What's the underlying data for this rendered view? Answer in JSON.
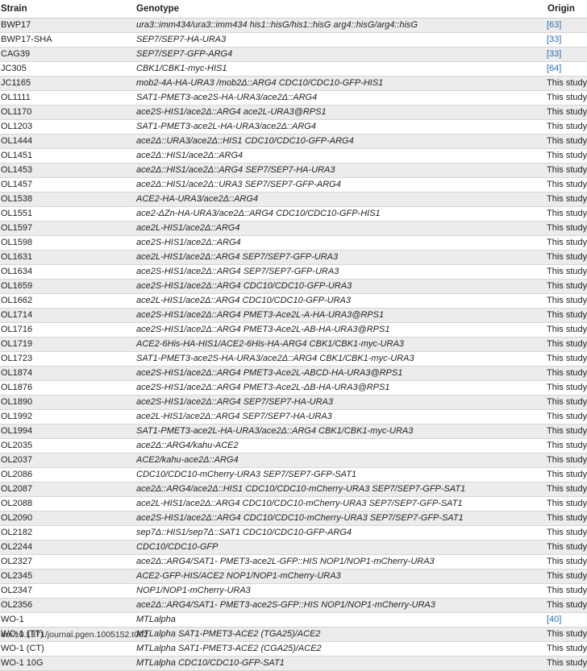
{
  "table": {
    "headers": [
      "Strain",
      "Genotype",
      "Origin"
    ],
    "rows": [
      {
        "strain": "BWP17",
        "genotype": "ura3::imm434/ura3::imm434 his1::hisG/his1::hisG arg4::hisG/arg4::hisG",
        "origin": "[63]",
        "origin_is_ref": true
      },
      {
        "strain": "BWP17-SHA",
        "genotype": "SEP7/SEP7-HA-URA3",
        "origin": "[33]",
        "origin_is_ref": true
      },
      {
        "strain": "CAG39",
        "genotype": "SEP7/SEP7-GFP-ARG4",
        "origin": "[33]",
        "origin_is_ref": true
      },
      {
        "strain": "JC305",
        "genotype": "CBK1/CBK1-myc-HIS1",
        "origin": "[64]",
        "origin_is_ref": true
      },
      {
        "strain": "JC1165",
        "genotype": "mob2-4A-HA-URA3 /mob2Δ::ARG4 CDC10/CDC10-GFP-HIS1",
        "origin": "This study",
        "origin_is_ref": false
      },
      {
        "strain": "OL1111",
        "genotype": "SAT1-PMET3-ace2S-HA-URA3/ace2Δ::ARG4",
        "origin": "This study",
        "origin_is_ref": false
      },
      {
        "strain": "OL1170",
        "genotype": "ace2S-HIS1/ace2Δ::ARG4 ace2L-URA3@RPS1",
        "origin": "This study",
        "origin_is_ref": false
      },
      {
        "strain": "OL1203",
        "genotype": "SAT1-PMET3-ace2L-HA-URA3/ace2Δ::ARG4",
        "origin": "This study",
        "origin_is_ref": false
      },
      {
        "strain": "OL1444",
        "genotype": "ace2Δ::URA3/ace2Δ::HIS1 CDC10/CDC10-GFP-ARG4",
        "origin": "This study",
        "origin_is_ref": false
      },
      {
        "strain": "OL1451",
        "genotype": "ace2Δ::HIS1/ace2Δ::ARG4",
        "origin": "This study",
        "origin_is_ref": false
      },
      {
        "strain": "OL1453",
        "genotype": "ace2Δ::HIS1/ace2Δ::ARG4 SEP7/SEP7-HA-URA3",
        "origin": "This study",
        "origin_is_ref": false
      },
      {
        "strain": "OL1457",
        "genotype": "ace2Δ::HIS1/ace2Δ::URA3 SEP7/SEP7-GFP-ARG4",
        "origin": "This study",
        "origin_is_ref": false
      },
      {
        "strain": "OL1538",
        "genotype": "ACE2-HA-URA3/ace2Δ::ARG4",
        "origin": "This study",
        "origin_is_ref": false
      },
      {
        "strain": "OL1551",
        "genotype": "ace2-ΔZn-HA-URA3/ace2Δ::ARG4 CDC10/CDC10-GFP-HIS1",
        "origin": "This study",
        "origin_is_ref": false
      },
      {
        "strain": "OL1597",
        "genotype": "ace2L-HIS1/ace2Δ::ARG4",
        "origin": "This study",
        "origin_is_ref": false
      },
      {
        "strain": "OL1598",
        "genotype": "ace2S-HIS1/ace2Δ::ARG4",
        "origin": "This study",
        "origin_is_ref": false
      },
      {
        "strain": "OL1631",
        "genotype": "ace2L-HIS1/ace2Δ::ARG4 SEP7/SEP7-GFP-URA3",
        "origin": "This study",
        "origin_is_ref": false
      },
      {
        "strain": "OL1634",
        "genotype": "ace2S-HIS1/ace2Δ::ARG4 SEP7/SEP7-GFP-URA3",
        "origin": "This study",
        "origin_is_ref": false
      },
      {
        "strain": "OL1659",
        "genotype": "ace2S-HIS1/ace2Δ::ARG4 CDC10/CDC10-GFP-URA3",
        "origin": "This study",
        "origin_is_ref": false
      },
      {
        "strain": "OL1662",
        "genotype": "ace2L-HIS1/ace2Δ::ARG4 CDC10/CDC10-GFP-URA3",
        "origin": "This study",
        "origin_is_ref": false
      },
      {
        "strain": "OL1714",
        "genotype": "ace2S-HIS1/ace2Δ::ARG4 PMET3-Ace2L-A-HA-URA3@RPS1",
        "origin": "This study",
        "origin_is_ref": false
      },
      {
        "strain": "OL1716",
        "genotype": "ace2S-HIS1/ace2Δ::ARG4 PMET3-Ace2L-AB-HA-URA3@RPS1",
        "origin": "This study",
        "origin_is_ref": false
      },
      {
        "strain": "OL1719",
        "genotype": "ACE2-6His-HA-HIS1/ACE2-6His-HA-ARG4 CBK1/CBK1-myc-URA3",
        "origin": "This study",
        "origin_is_ref": false
      },
      {
        "strain": "OL1723",
        "genotype": "SAT1-PMET3-ace2S-HA-URA3/ace2Δ::ARG4 CBK1/CBK1-myc-URA3",
        "origin": "This study",
        "origin_is_ref": false
      },
      {
        "strain": "OL1874",
        "genotype": "ace2S-HIS1/ace2Δ::ARG4 PMET3-Ace2L-ABCD-HA-URA3@RPS1",
        "origin": "This study",
        "origin_is_ref": false
      },
      {
        "strain": "OL1876",
        "genotype": "ace2S-HIS1/ace2Δ::ARG4 PMET3-Ace2L-ΔB-HA-URA3@RPS1",
        "origin": "This study",
        "origin_is_ref": false
      },
      {
        "strain": "OL1890",
        "genotype": "ace2S-HIS1/ace2Δ::ARG4 SEP7/SEP7-HA-URA3",
        "origin": "This study",
        "origin_is_ref": false
      },
      {
        "strain": "OL1992",
        "genotype": "ace2L-HIS1/ace2Δ::ARG4 SEP7/SEP7-HA-URA3",
        "origin": "This study",
        "origin_is_ref": false
      },
      {
        "strain": "OL1994",
        "genotype": "SAT1-PMET3-ace2L-HA-URA3/ace2Δ::ARG4 CBK1/CBK1-myc-URA3",
        "origin": "This study",
        "origin_is_ref": false
      },
      {
        "strain": "OL2035",
        "genotype": "ace2Δ::ARG4/kahu-ACE2",
        "origin": "This study",
        "origin_is_ref": false
      },
      {
        "strain": "OL2037",
        "genotype": "ACE2/kahu-ace2Δ::ARG4",
        "origin": "This study",
        "origin_is_ref": false
      },
      {
        "strain": "OL2086",
        "genotype": "CDC10/CDC10-mCherry-URA3 SEP7/SEP7-GFP-SAT1",
        "origin": "This study",
        "origin_is_ref": false
      },
      {
        "strain": "OL2087",
        "genotype": "ace2Δ::ARG4/ace2Δ::HIS1 CDC10/CDC10-mCherry-URA3 SEP7/SEP7-GFP-SAT1",
        "origin": "This study",
        "origin_is_ref": false
      },
      {
        "strain": "OL2088",
        "genotype": "ace2L-HIS1/ace2Δ::ARG4 CDC10/CDC10-mCherry-URA3 SEP7/SEP7-GFP-SAT1",
        "origin": "This study",
        "origin_is_ref": false
      },
      {
        "strain": "OL2090",
        "genotype": "ace2S-HIS1/ace2Δ::ARG4 CDC10/CDC10-mCherry-URA3 SEP7/SEP7-GFP-SAT1",
        "origin": "This study",
        "origin_is_ref": false
      },
      {
        "strain": "OL2182",
        "genotype": "sep7Δ::HIS1/sep7Δ::SAT1 CDC10/CDC10-GFP-ARG4",
        "origin": "This study",
        "origin_is_ref": false
      },
      {
        "strain": "OL2244",
        "genotype": "CDC10/CDC10-GFP",
        "origin": "This study",
        "origin_is_ref": false
      },
      {
        "strain": "OL2327",
        "genotype": "ace2Δ::ARG4/SAT1- PMET3-ace2L-GFP::HIS NOP1/NOP1-mCherry-URA3",
        "origin": "This study",
        "origin_is_ref": false
      },
      {
        "strain": "OL2345",
        "genotype": "ACE2-GFP-HIS/ACE2 NOP1/NOP1-mCherry-URA3",
        "origin": "This study",
        "origin_is_ref": false
      },
      {
        "strain": "OL2347",
        "genotype": "NOP1/NOP1-mCherry-URA3",
        "origin": "This study",
        "origin_is_ref": false
      },
      {
        "strain": "OL2356",
        "genotype": "ace2Δ::ARG4/SAT1- PMET3-ace2S-GFP::HIS NOP1/NOP1-mCherry-URA3",
        "origin": "This study",
        "origin_is_ref": false
      },
      {
        "strain": "WO-1",
        "genotype": "MTLalpha",
        "origin": "[40]",
        "origin_is_ref": true
      },
      {
        "strain": "WO-1 (TT)",
        "genotype": "MTLalpha SAT1-PMET3-ACE2 (TGA25)/ACE2",
        "origin": "This study",
        "origin_is_ref": false
      },
      {
        "strain": "WO-1 (CT)",
        "genotype": "MTLalpha SAT1-PMET3-ACE2 (CGA25)/ACE2",
        "origin": "This study",
        "origin_is_ref": false
      },
      {
        "strain": "WO-1 10G",
        "genotype": "MTLalpha CDC10/CDC10-GFP-SAT1",
        "origin": "This study",
        "origin_is_ref": false
      }
    ]
  },
  "doi": "doi:10.1371/journal.pgen.1005152.t002"
}
